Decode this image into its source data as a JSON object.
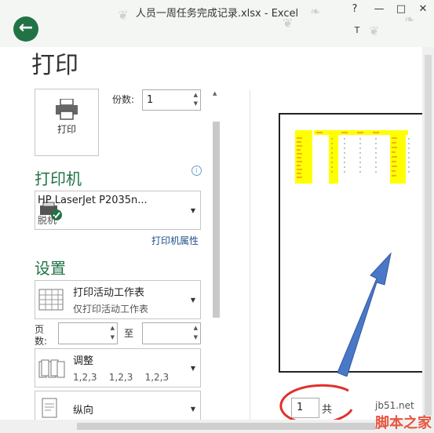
{
  "window": {
    "title": "人员一周任务完成记录.xlsx - Excel",
    "help": "?",
    "minimize": "—",
    "restore": "□",
    "close": "✕",
    "extra": "T"
  },
  "back_icon": "back-arrow-icon",
  "page_title": "打印",
  "print_button": {
    "label": "打印",
    "icon": "printer-icon"
  },
  "copies": {
    "label": "份数:",
    "value": "1"
  },
  "printer_section": {
    "heading": "打印机",
    "info": "i",
    "name": "HP LaserJet P2035n...",
    "status": "脱机",
    "properties_link": "打印机属性"
  },
  "settings_section": {
    "heading": "设置",
    "scope": {
      "title": "打印活动工作表",
      "sub": "仅打印活动工作表"
    },
    "pages": {
      "label_line1": "页",
      "label_line2": "数:",
      "to": "至",
      "from_value": "",
      "to_value": ""
    },
    "collate": {
      "title": "调整",
      "sub": "1,2,3    1,2,3    1,2,3"
    },
    "orientation": {
      "title": "纵向"
    }
  },
  "preview": {
    "page_input": "1",
    "total_prefix": "共"
  },
  "watermark": {
    "line1": "jb51.net",
    "line2": "脚本之家"
  },
  "colors": {
    "accent": "#217346",
    "highlight": "#ffff00",
    "arrow": "#4a78c8",
    "annotation": "#e0302a"
  }
}
